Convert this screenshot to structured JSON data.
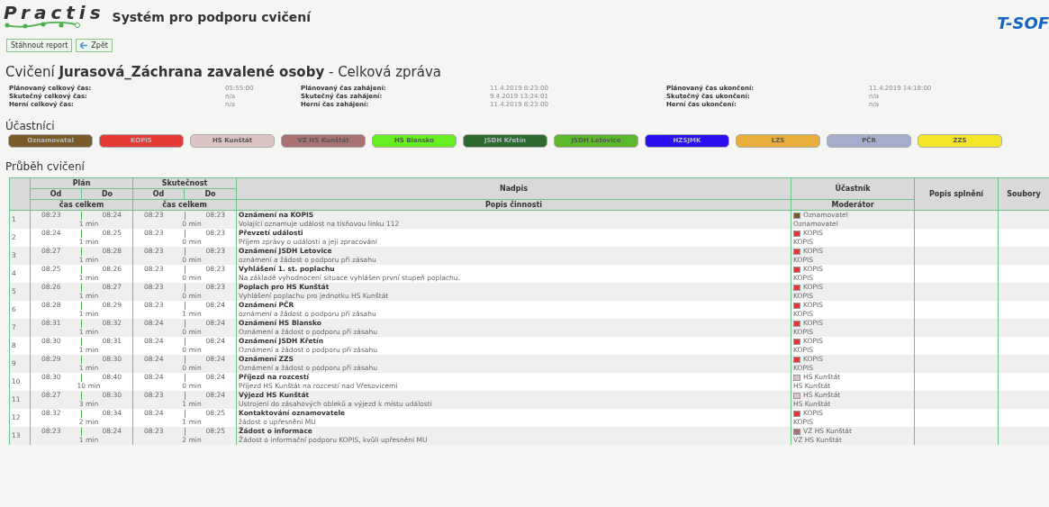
{
  "header": {
    "logo": "Practis",
    "title": "Systém pro podporu cvičení",
    "brand": "T-SOF"
  },
  "buttons": [
    {
      "kind": "plain",
      "label": "Stáhnout report"
    },
    {
      "kind": "back",
      "label": "Zpět"
    }
  ],
  "heading": {
    "prefix": "Cvičení",
    "name": "Jurasová_Záchrana zavalené osoby",
    "suffix": "- Celková zpráva"
  },
  "summary": [
    [
      {
        "label": "Plánovaný celkový čas:",
        "value": "05:55:00"
      },
      {
        "label": "Skutečný celkový čas:",
        "value": "n/a"
      },
      {
        "label": "Herní celkový čas:",
        "value": "n/a"
      }
    ],
    [
      {
        "label": "Plánovaný čas zahájení:",
        "value": "11.4.2019 8:23:00"
      },
      {
        "label": "Skutečný čas zahájení:",
        "value": "9.4.2019 13:24:01"
      },
      {
        "label": "Herní čas zahájení:",
        "value": "11.4.2019 8:23:00"
      }
    ],
    [
      {
        "label": "Plánovaný čas ukončení:",
        "value": "11.4.2019 14:18:00"
      },
      {
        "label": "Skutečný čas ukončení:",
        "value": "n/a"
      },
      {
        "label": "Herní čas ukončení:",
        "value": "n/a"
      }
    ]
  ],
  "participants_title": "Účastníci",
  "participants": [
    {
      "label": "Oznamovatel",
      "color": "#7a5a2a"
    },
    {
      "label": "KOPIS",
      "color": "#e53935"
    },
    {
      "label": "HS Kunštát",
      "color": "#dcc4c4"
    },
    {
      "label": "VZ HS Kunštát",
      "color": "#a87272"
    },
    {
      "label": "HS Blansko",
      "color": "#66ee22"
    },
    {
      "label": "JSDH Křetín",
      "color": "#2e6b2e"
    },
    {
      "label": "JSDH Letovice",
      "color": "#5cb82a"
    },
    {
      "label": "HZSJMK",
      "color": "#2a10f0"
    },
    {
      "label": "LZS",
      "color": "#e8ad3a"
    },
    {
      "label": "PČR",
      "color": "#a5adcc"
    },
    {
      "label": "ZZS",
      "color": "#f4e52a"
    }
  ],
  "progress_title": "Průběh cvičení",
  "table": {
    "plan": "Plán",
    "actual": "Skutečnost",
    "plan_from": "Od",
    "plan_to": "Do",
    "plan_total": "čas celkem",
    "act_from": "Od",
    "act_to": "Do",
    "act_total": "čas celkem",
    "heading": "Nadpis",
    "description": "Popis činnosti",
    "participant": "Účastník",
    "moderator": "Moderátor",
    "completion": "Popis splnění",
    "files": "Soubory",
    "rows": [
      {
        "n": "1",
        "plan_from": "08:23",
        "plan_to": "08:24",
        "plan_total": "1 min",
        "act_from": "08:23",
        "act_to": "08:23",
        "act_total": "0 min",
        "title": "Oznámení na KOPIS",
        "desc": "Volající oznamuje událost na tísňovou linku 112",
        "participant": "Oznamovatel",
        "color": "#7a5a2a",
        "moderator": "Oznamovatel"
      },
      {
        "n": "2",
        "plan_from": "08:24",
        "plan_to": "08:25",
        "plan_total": "1 min",
        "act_from": "08:23",
        "act_to": "08:23",
        "act_total": "0 min",
        "title": "Převzetí události",
        "desc": "Příjem zprávy o události a její zpracování",
        "participant": "KOPIS",
        "color": "#e53935",
        "moderator": "KOPIS"
      },
      {
        "n": "3",
        "plan_from": "08:27",
        "plan_to": "08:28",
        "plan_total": "1 min",
        "act_from": "08:23",
        "act_to": "08:23",
        "act_total": "0 min",
        "title": "Oznámení JSDH Letovice",
        "desc": "oznámení a žádost o podporu při zásahu",
        "participant": "KOPIS",
        "color": "#e53935",
        "moderator": "KOPIS"
      },
      {
        "n": "4",
        "plan_from": "08:25",
        "plan_to": "08:26",
        "plan_total": "1 min",
        "act_from": "08:23",
        "act_to": "08:23",
        "act_total": "0 min",
        "title": "Vyhlášení 1. st. poplachu",
        "desc": "Na základě vyhodnocení situace vyhlášen první stupeň poplachu.",
        "participant": "KOPIS",
        "color": "#e53935",
        "moderator": "KOPIS"
      },
      {
        "n": "5",
        "plan_from": "08:26",
        "plan_to": "08:27",
        "plan_total": "1 min",
        "act_from": "08:23",
        "act_to": "08:23",
        "act_total": "0 min",
        "title": "Poplach pro HS Kunštát",
        "desc": "Vyhlášení poplachu pro jednotku HS Kunštát",
        "participant": "KOPIS",
        "color": "#e53935",
        "moderator": "KOPIS"
      },
      {
        "n": "6",
        "plan_from": "08:28",
        "plan_to": "08:29",
        "plan_total": "1 min",
        "act_from": "08:23",
        "act_to": "08:24",
        "act_total": "1 min",
        "title": "Oznámení PČR",
        "desc": "oznámení a žádost o podporu při zásahu",
        "participant": "KOPIS",
        "color": "#e53935",
        "moderator": "KOPIS"
      },
      {
        "n": "7",
        "plan_from": "08:31",
        "plan_to": "08:32",
        "plan_total": "1 min",
        "act_from": "08:24",
        "act_to": "08:24",
        "act_total": "0 min",
        "title": "Oznámení HS Blansko",
        "desc": "Oznámení a žádost o podporu při zásahu",
        "participant": "KOPIS",
        "color": "#e53935",
        "moderator": "KOPIS"
      },
      {
        "n": "8",
        "plan_from": "08:30",
        "plan_to": "08:31",
        "plan_total": "1 min",
        "act_from": "08:24",
        "act_to": "08:24",
        "act_total": "0 min",
        "title": "Oznámení JSDH Křetín",
        "desc": "Oznámení a žádost o podporu při zásahu",
        "participant": "KOPIS",
        "color": "#e53935",
        "moderator": "KOPIS"
      },
      {
        "n": "9",
        "plan_from": "08:29",
        "plan_to": "08:30",
        "plan_total": "1 min",
        "act_from": "08:24",
        "act_to": "08:24",
        "act_total": "0 min",
        "title": "Oznámení ZZS",
        "desc": "Oznámení a žádost o podporu při zásahu",
        "participant": "KOPIS",
        "color": "#e53935",
        "moderator": "KOPIS"
      },
      {
        "n": "10",
        "plan_from": "08:30",
        "plan_to": "08:40",
        "plan_total": "10 min",
        "act_from": "08:24",
        "act_to": "08:24",
        "act_total": "0 min",
        "title": "Příjezd na rozcestí",
        "desc": "Příjezd HS Kunštát na rozcestí nad Vřesovicemi",
        "participant": "HS Kunštát",
        "color": "#dcc4c4",
        "moderator": "HS Kunštát"
      },
      {
        "n": "11",
        "plan_from": "08:27",
        "plan_to": "08:30",
        "plan_total": "3 min",
        "act_from": "08:23",
        "act_to": "08:24",
        "act_total": "1 min",
        "title": "Výjezd HS Kunštát",
        "desc": "Ustrojení do zásahových obleků a výjezd k místu události",
        "participant": "HS Kunštát",
        "color": "#dcc4c4",
        "moderator": "HS Kunštát"
      },
      {
        "n": "12",
        "plan_from": "08:32",
        "plan_to": "08:34",
        "plan_total": "2 min",
        "act_from": "08:24",
        "act_to": "08:25",
        "act_total": "1 min",
        "title": "Kontaktování oznamovatele",
        "desc": "žádost o upřesnění MU",
        "participant": "KOPIS",
        "color": "#e53935",
        "moderator": "KOPIS"
      },
      {
        "n": "13",
        "plan_from": "08:23",
        "plan_to": "08:24",
        "plan_total": "1 min",
        "act_from": "08:23",
        "act_to": "08:25",
        "act_total": "2 min",
        "title": "Žádost o informace",
        "desc": "Žádost o informační podporu KOPIS, kvůli upřesnění MU",
        "participant": "VZ HS Kunštát",
        "color": "#a87272",
        "moderator": "VZ HS Kunštát"
      }
    ]
  }
}
